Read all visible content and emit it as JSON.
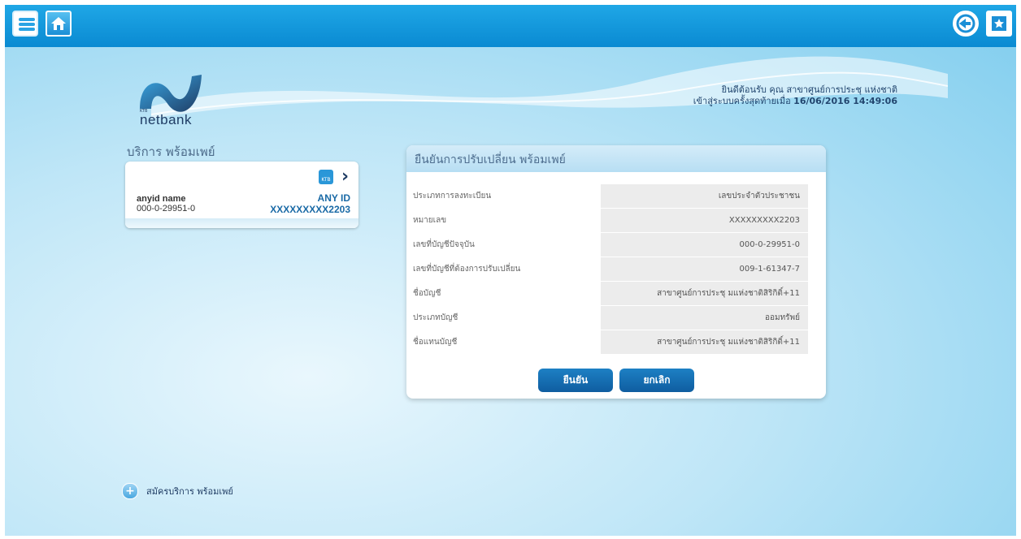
{
  "header": {
    "icons": [
      "menu-icon",
      "home-icon",
      "logout-icon",
      "favorite-icon"
    ]
  },
  "brand": {
    "logo_small": "KTB",
    "logo_text": "netbank"
  },
  "welcome": {
    "line1": "ยินดีต้อนรับ คุณ สาขาศูนย์การประชุ แห่งชาติ",
    "line2_prefix": "เข้าสู่ระบบครั้งสุดท้ายเมื่อ",
    "line2_datetime": "16/06/2016 14:49:06"
  },
  "sidebar": {
    "section_title": "บริการ พร้อมเพย์",
    "card": {
      "name": "anyid name",
      "account": "000-0-29951-0",
      "id_label": "ANY ID",
      "id_value": "XXXXXXXXX2203",
      "ktb_badge": "KTB"
    },
    "register_label": "สมัครบริการ พร้อมเพย์"
  },
  "panel": {
    "title": "ยืนยันการปรับเปลี่ยน พร้อมเพย์",
    "rows": [
      {
        "label": "ประเภทการลงทะเบียน",
        "value": "เลขประจำตัวประชาชน"
      },
      {
        "label": "หมายเลข",
        "value": "XXXXXXXXX2203"
      },
      {
        "label": "เลขที่บัญชีปัจจุบัน",
        "value": "000-0-29951-0"
      },
      {
        "label": "เลขที่บัญชีที่ต้องการปรับเปลี่ยน",
        "value": "009-1-61347-7"
      },
      {
        "label": "ชื่อบัญชี",
        "value": "สาขาศูนย์การประชุ มแห่งชาติสิริกิติ์+11"
      },
      {
        "label": "ประเภทบัญชี",
        "value": "ออมทรัพย์"
      },
      {
        "label": "ชื่อแทนบัญชี",
        "value": "สาขาศูนย์การประชุ มแห่งชาติสิริกิติ์+11"
      }
    ],
    "confirm_label": "ยืนยัน",
    "cancel_label": "ยกเลิก"
  },
  "colors": {
    "topbar": "#0a8ad2",
    "button": "#0f5da0",
    "accent_text": "#1a6aa6"
  }
}
